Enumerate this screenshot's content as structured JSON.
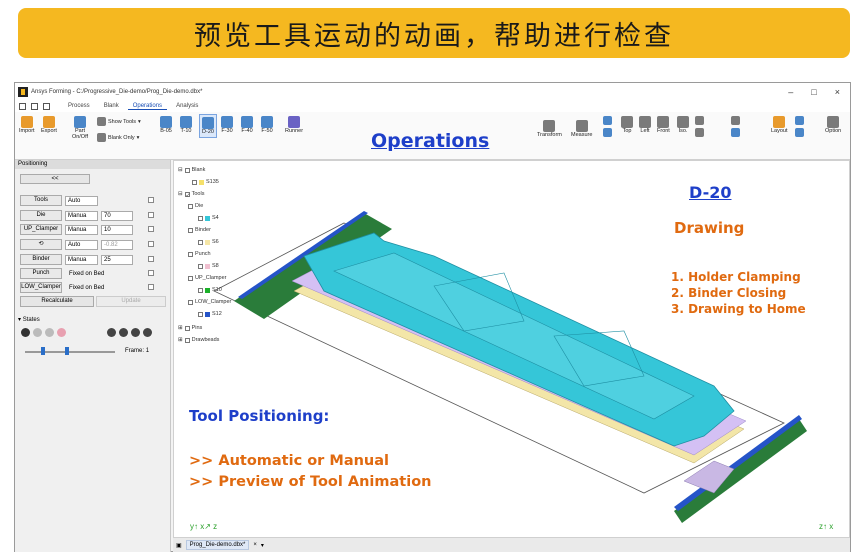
{
  "banner": {
    "text": "预览工具运动的动画，帮助进行检查"
  },
  "window": {
    "title": "Ansys Forming - C:/Progressive_Die-demo/Prog_Die-demo.dbx*",
    "controls": [
      "–",
      "□",
      "×"
    ],
    "tabs": [
      "Process",
      "Blank",
      "Operations",
      "Analysis"
    ],
    "active_tab": "Operations"
  },
  "ribbon": {
    "import": "Import",
    "export": "Export",
    "part": "Part On/Off",
    "show_tools": "Show Tools",
    "blank_only": "Blank Only",
    "ops": [
      "B-05",
      "T-10",
      "D-20",
      "F-30",
      "F-40",
      "F-50"
    ],
    "runner": "Runner",
    "transform": "Transform",
    "measure": "Measure",
    "views": [
      "Top",
      "Left",
      "Front",
      "Iso."
    ],
    "layout": "Layout",
    "option": "Option"
  },
  "overlay": {
    "operations": "Operations",
    "d20": "D-20",
    "drawing": "Drawing",
    "steps": [
      "1. Holder Clamping",
      "2. Binder Closing",
      "3. Drawing to Home"
    ],
    "tool_positioning": "Tool Positioning:",
    "bullets": [
      ">> Automatic or Manual",
      ">> Preview of Tool Animation"
    ]
  },
  "positioning": {
    "title": "Positioning",
    "back": "<<",
    "rows": [
      {
        "name": "Tools",
        "mode": "Auto",
        "value": ""
      },
      {
        "name": "Die",
        "mode": "Manua",
        "value": "70"
      },
      {
        "name": "UP_Clamper",
        "mode": "Manua",
        "value": "10"
      },
      {
        "name": "",
        "mode": "Auto",
        "value": "-0.82"
      },
      {
        "name": "Binder",
        "mode": "Manua",
        "value": "25"
      },
      {
        "name": "Punch",
        "mode": "Fixed on Bed",
        "value": ""
      },
      {
        "name": "LOW_Clamper",
        "mode": "Fixed on Bed",
        "value": ""
      }
    ],
    "recalculate": "Recalculate",
    "update": "Update",
    "states": "States",
    "frame_label": "Frame:",
    "frame_value": "1"
  },
  "tree": {
    "blank": "Blank",
    "s135": "S135",
    "tools": "Tools",
    "die": "Die",
    "s4": "S4",
    "binder": "Binder",
    "s6": "S6",
    "punch": "Punch",
    "s8": "S8",
    "up_clamper": "UP_Clamper",
    "s10": "S10",
    "low_clamper": "LOW_Clamper",
    "s12": "S12",
    "pins": "Pins",
    "drawbeads": "Drawbeads"
  },
  "status": {
    "doc": "Prog_Die-demo.dbx*",
    "close": "×"
  },
  "colors": {
    "banner": "#f5b820",
    "ops_title": "#1e3fc9",
    "orange": "#e06a10",
    "die": "#35c6d8",
    "binder": "#c8b8ff",
    "punch": "#f5e6a6"
  }
}
